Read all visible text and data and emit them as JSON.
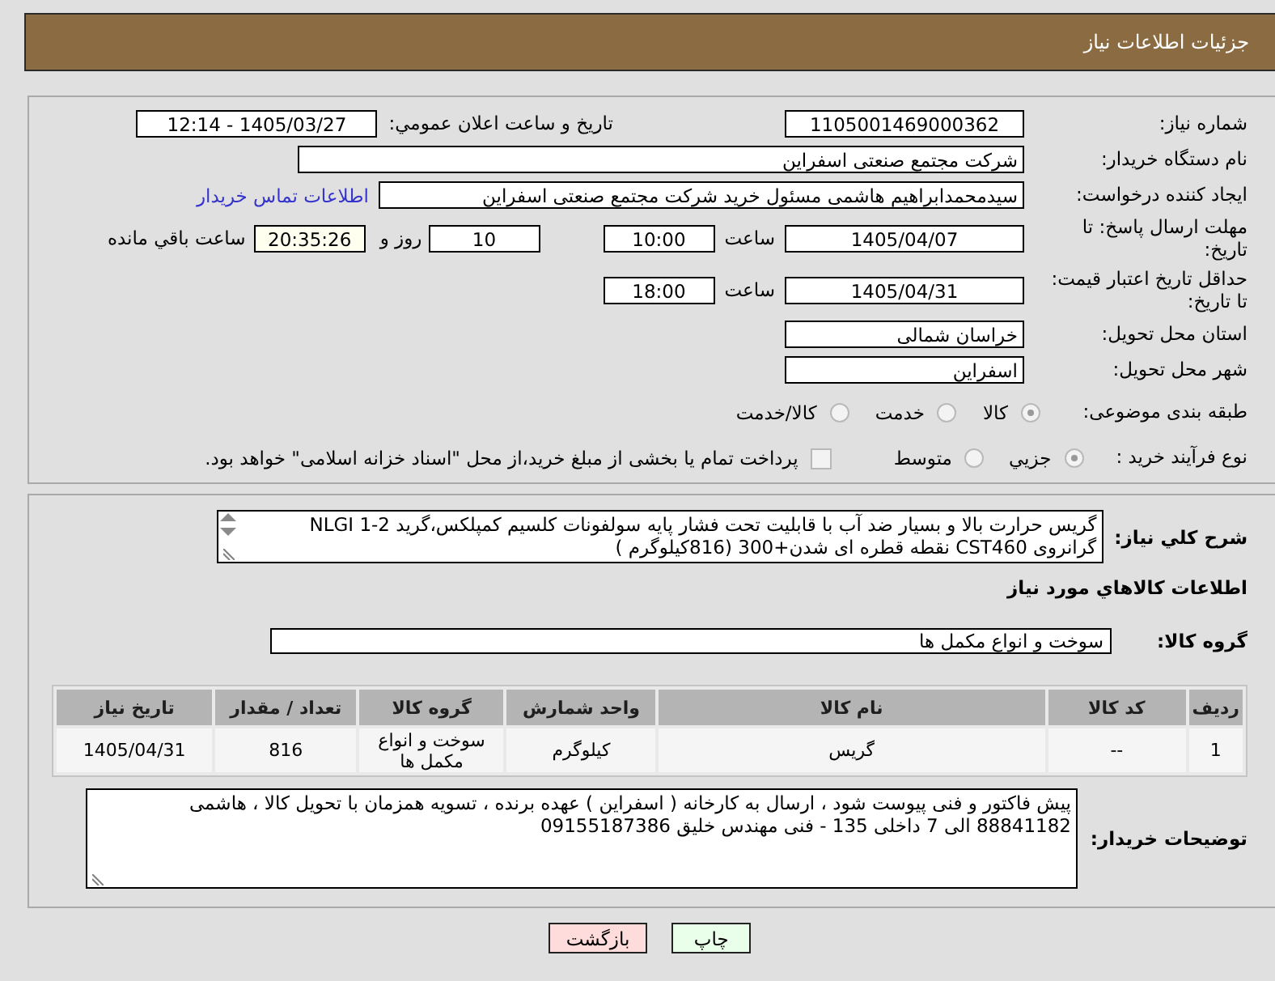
{
  "header": {
    "title": "جزئیات اطلاعات نیاز"
  },
  "details": {
    "need_number": {
      "label": "شماره نیاز:",
      "value": "1105001469000362"
    },
    "announce_date": {
      "label": "تاریخ و ساعت اعلان عمومي:",
      "value": "1405/03/27 - 12:14"
    },
    "buyer_org": {
      "label": "نام دستگاه خریدار:",
      "value": "شرکت مجتمع صنعتی اسفراین"
    },
    "requester": {
      "label": "ایجاد کننده درخواست:",
      "value": "سیدمحمدابراهیم هاشمی مسئول خرید شرکت مجتمع صنعتی اسفراین",
      "contact_link": "اطلاعات تماس خریدار"
    },
    "reply_deadline": {
      "label": "مهلت ارسال پاسخ: تا تاریخ:",
      "date": "1405/04/07",
      "time_label": "ساعت",
      "time": "10:00",
      "days": "10",
      "days_label": "روز و",
      "remaining": "20:35:26",
      "remaining_label": "ساعت باقي مانده"
    },
    "price_validity": {
      "label": "حداقل تاریخ اعتبار قیمت: تا تاریخ:",
      "date": "1405/04/31",
      "time_label": "ساعت",
      "time": "18:00"
    },
    "province": {
      "label": "استان محل تحویل:",
      "value": "خراسان شمالی"
    },
    "city": {
      "label": "شهر محل تحویل:",
      "value": "اسفراین"
    },
    "category": {
      "label": "طبقه بندی موضوعی:",
      "options": [
        {
          "label": "کالا",
          "selected": true
        },
        {
          "label": "خدمت",
          "selected": false
        },
        {
          "label": "کالا/خدمت",
          "selected": false
        }
      ]
    },
    "purchase_process": {
      "label": "نوع فرآیند خرید :",
      "options": [
        {
          "label": "جزيي",
          "selected": true
        },
        {
          "label": "متوسط",
          "selected": false
        }
      ],
      "treasury_payment": {
        "label": "پرداخت تمام یا بخشی از مبلغ خرید،از محل \"اسناد خزانه اسلامی\" خواهد بود.",
        "checked": false
      }
    }
  },
  "needs": {
    "description": {
      "label": "شرح کلي نياز:",
      "value": "گریس حرارت بالا و بسیار ضد آب با قابلیت تحت فشار پایه سولفونات کلسیم کمپلکس،گرید NLGI 1-2 گرانروی CST460 نقطه قطره ای شدن+300 (816کیلوگرم )"
    },
    "goods_title": "اطلاعات کالاهاي مورد نياز",
    "goods_group": {
      "label": "گروه کالا:",
      "value": "سوخت و انواع مکمل ها"
    },
    "table": {
      "columns": [
        "ردیف",
        "کد کالا",
        "نام کالا",
        "واحد شمارش",
        "گروه کالا",
        "تعداد / مقدار",
        "تاریخ نیاز"
      ],
      "rows": [
        [
          "1",
          "--",
          "گریس",
          "کیلوگرم",
          "سوخت و انواع مکمل ها",
          "816",
          "1405/04/31"
        ]
      ]
    },
    "buyer_notes": {
      "label": "توضیحات خریدار:",
      "value": "پیش فاکتور و فنی پیوست شود ، ارسال به کارخانه ( اسفراین ) عهده برنده ، تسویه همزمان با تحویل کالا ، هاشمی 88841182 الی 7 داخلی 135 - فنی مهندس خلیق 09155187386"
    }
  },
  "buttons": [
    {
      "label": "چاپ",
      "kind": "print"
    },
    {
      "label": "بازگشت",
      "kind": "back"
    }
  ]
}
